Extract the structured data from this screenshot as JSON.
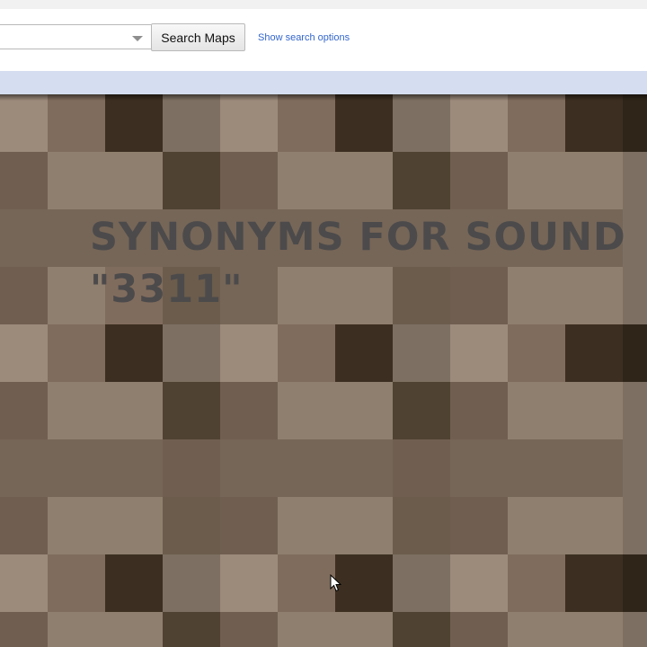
{
  "search": {
    "input_value": "",
    "button_label": "Search Maps",
    "options_link": "Show search options"
  },
  "map": {
    "overlay_title": "SYNONYMS FOR SOUND \"3311\"",
    "tile_palette": [
      "#9c8b7b",
      "#806c5d",
      "#3c2f21",
      "#7d7062",
      "#8f7f6e",
      "#705f51",
      "#4f4232",
      "#766657",
      "#6b5c4c",
      "#2f2619"
    ],
    "tile_rows": [
      [
        0,
        1,
        2,
        3,
        0,
        1,
        2,
        3,
        0,
        1,
        2,
        9
      ],
      [
        5,
        4,
        4,
        6,
        5,
        4,
        4,
        6,
        5,
        4,
        4,
        3
      ],
      [
        7,
        7,
        7,
        7,
        7,
        7,
        7,
        7,
        7,
        7,
        7,
        3
      ],
      [
        5,
        4,
        1,
        8,
        7,
        4,
        4,
        8,
        5,
        4,
        4,
        3
      ],
      [
        0,
        1,
        2,
        3,
        0,
        1,
        2,
        3,
        0,
        1,
        2,
        9
      ],
      [
        5,
        4,
        4,
        6,
        5,
        4,
        4,
        6,
        5,
        4,
        4,
        3
      ],
      [
        7,
        7,
        7,
        5,
        7,
        7,
        7,
        5,
        7,
        7,
        7,
        3
      ],
      [
        5,
        4,
        4,
        8,
        5,
        4,
        4,
        8,
        5,
        4,
        4,
        3
      ],
      [
        0,
        1,
        2,
        3,
        0,
        1,
        2,
        3,
        0,
        1,
        2,
        9
      ],
      [
        5,
        4,
        4,
        6,
        5,
        4,
        4,
        6,
        5,
        4,
        4,
        3
      ]
    ]
  },
  "icons": {
    "dropdown": "chevron-down-icon",
    "cursor": "mouse-pointer-icon"
  }
}
